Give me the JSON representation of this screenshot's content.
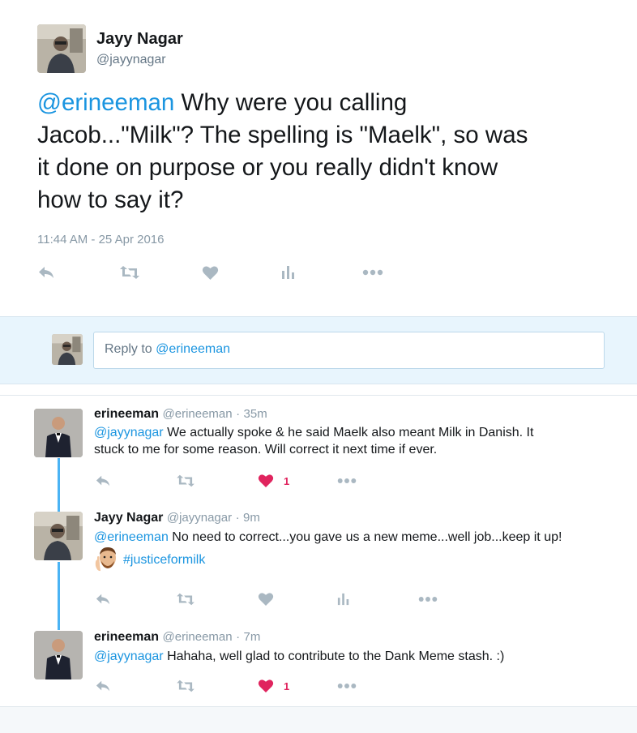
{
  "main_tweet": {
    "author_name": "Jayy Nagar",
    "author_handle": "@jayynagar",
    "mention": "@erineeman",
    "text_line1": " Why were you calling",
    "text_line2": "Jacob...\"Milk\"? The spelling is \"Maelk\", so was",
    "text_line3": "it done on purpose or you really didn't know",
    "text_line4": "how to say it?",
    "timestamp": "11:44 AM - 25 Apr 2016",
    "actions": [
      "reply-icon",
      "retweet-icon",
      "like-icon",
      "analytics-icon",
      "more-icon"
    ]
  },
  "reply_box": {
    "placeholder_prefix": "Reply to ",
    "placeholder_mention": "@erineeman"
  },
  "replies": [
    {
      "name": "erineeman",
      "handle": "@erineeman",
      "time": "35m",
      "mention": "@jayynagar",
      "line1": " We actually spoke & he said Maelk also meant Milk in Danish. It",
      "line2": "stuck to me for some reason. Will correct it next time if ever.",
      "likes": "1",
      "liked": true
    },
    {
      "name": "Jayy Nagar",
      "handle": "@jayynagar",
      "time": "9m",
      "mention": "@erineeman",
      "line1": " No need to correct...you gave us a new meme...well job...keep it up!",
      "hashtag": "#justiceformilk",
      "liked": false
    },
    {
      "name": "erineeman",
      "handle": "@erineeman",
      "time": "7m",
      "mention": "@jayynagar",
      "line1": " Hahaha, well glad to contribute to the Dank Meme stash. :)",
      "likes": "1",
      "liked": true
    }
  ],
  "separator": "·",
  "colors": {
    "link": "#1b95e0",
    "action_gray": "#aab8c2",
    "like_red": "#e0245e",
    "thread_line": "#4ab3f4",
    "reply_bar_bg": "#e8f5fd"
  }
}
